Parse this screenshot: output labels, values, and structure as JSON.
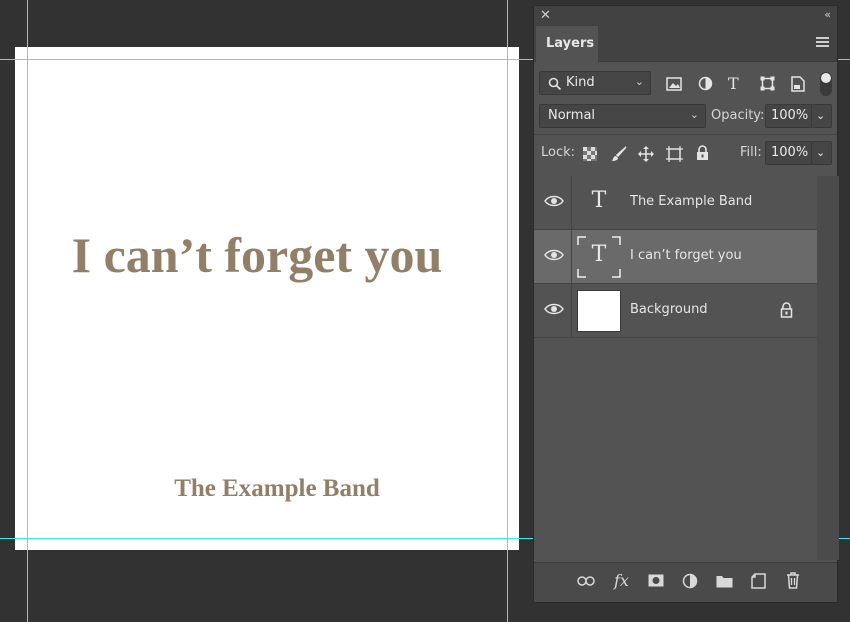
{
  "canvas": {
    "title_text": "I can’t forget you",
    "band_text": "The Example Band",
    "text_color": "#917f68",
    "guide_color": "#3ee8ea"
  },
  "panel": {
    "tab_label": "Layers",
    "filter_kind": "Kind",
    "blend_mode": "Normal",
    "opacity_label": "Opacity:",
    "opacity_value": "100%",
    "lock_label": "Lock:",
    "fill_label": "Fill:",
    "fill_value": "100%",
    "layers": [
      {
        "name": "The Example Band",
        "type": "text",
        "selected": false
      },
      {
        "name": "I can’t forget you",
        "type": "text",
        "selected": true
      },
      {
        "name": "Background",
        "type": "image",
        "selected": false,
        "locked": true
      }
    ],
    "text_thumb_glyph": "T",
    "filter_icons": [
      "image-filter-icon",
      "adjustment-filter-icon",
      "type-filter-icon",
      "shape-filter-icon",
      "smart-object-filter-icon"
    ],
    "lock_icons": [
      "lock-transparent-icon",
      "lock-image-icon",
      "lock-position-icon",
      "lock-artboard-icon",
      "lock-all-icon"
    ],
    "bottom_icons": [
      "link-icon",
      "fx-icon",
      "mask-icon",
      "adjustment-icon",
      "folder-icon",
      "new-layer-icon",
      "trash-icon"
    ],
    "fx_label": "fx"
  }
}
